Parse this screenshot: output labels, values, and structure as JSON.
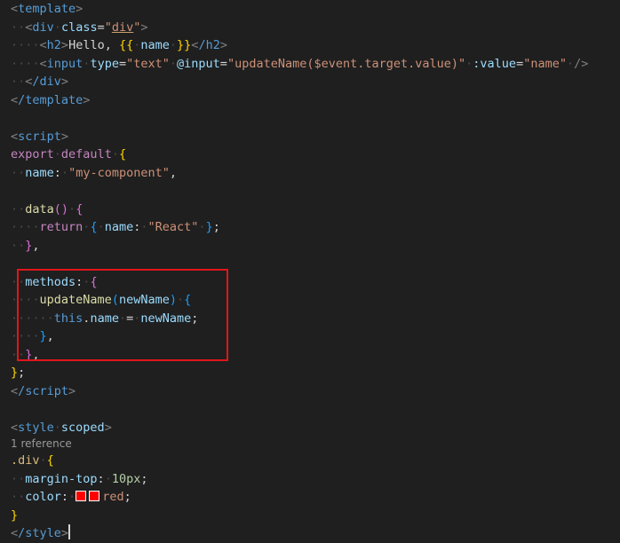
{
  "code": {
    "l1_open": "<",
    "l1_tag": "template",
    "l1_close": ">",
    "l2_tag": "div",
    "l2_attr": "class",
    "l2_eq": "=",
    "l2_q": "\"",
    "l2_val": "div",
    "l3_tag": "h2",
    "l3_text": "Hello, ",
    "l3_mopen": "{{",
    "l3_var": "name",
    "l3_mclose": "}}",
    "l3_endtag": "/h2",
    "l4_tag": "input",
    "l4_attr_type": "type",
    "l4_val_type": "\"text\"",
    "l4_attr_input": "@input",
    "l4_val_input": "\"updateName($event.target.value)\"",
    "l4_attr_value": ":value",
    "l4_val_value": "\"name\"",
    "l4_selfclose": "/>",
    "l5_endtag": "/div",
    "l6_endtag": "/template",
    "l8_tag": "script",
    "l9_export": "export",
    "l9_default": "default",
    "l9_brace": "{",
    "l10_key": "name",
    "l10_val": "\"my-component\"",
    "l10_comma": ",",
    "l12_fn": "data",
    "l12_parens": "()",
    "l12_brace": "{",
    "l13_return": "return",
    "l13_obrace": "{",
    "l13_key": "name",
    "l13_val": "\"React\"",
    "l13_cbrace": "}",
    "l13_semi": ";",
    "l14_cbrace": "}",
    "l14_comma": ",",
    "l16_key": "methods",
    "l16_brace": "{",
    "l17_fn": "updateName",
    "l17_oparen": "(",
    "l17_param": "newName",
    "l17_cparen": ")",
    "l17_brace": "{",
    "l18_this": "this",
    "l18_dot": ".",
    "l18_prop": "name",
    "l18_eq": "=",
    "l18_var": "newName",
    "l18_semi": ";",
    "l19_cbrace": "}",
    "l19_comma": ",",
    "l20_cbrace": "}",
    "l20_comma": ",",
    "l21_cbrace": "}",
    "l21_semi": ";",
    "l22_endtag": "/script",
    "l24_tag": "style",
    "l24_attr": "scoped",
    "ref_lens": "1 reference",
    "l25_selector": ".div",
    "l25_brace": "{",
    "l26_prop": "margin-top",
    "l26_colon": ":",
    "l26_val": "10px",
    "l26_semi": ";",
    "l27_prop": "color",
    "l27_colon": ":",
    "l27_val": "red",
    "l27_semi": ";",
    "l28_cbrace": "}",
    "l29_endtag": "/style"
  },
  "colors": {
    "background": "#1f1f1f",
    "highlight_box": "#e0161b",
    "swatch_red": "#ff0000"
  }
}
